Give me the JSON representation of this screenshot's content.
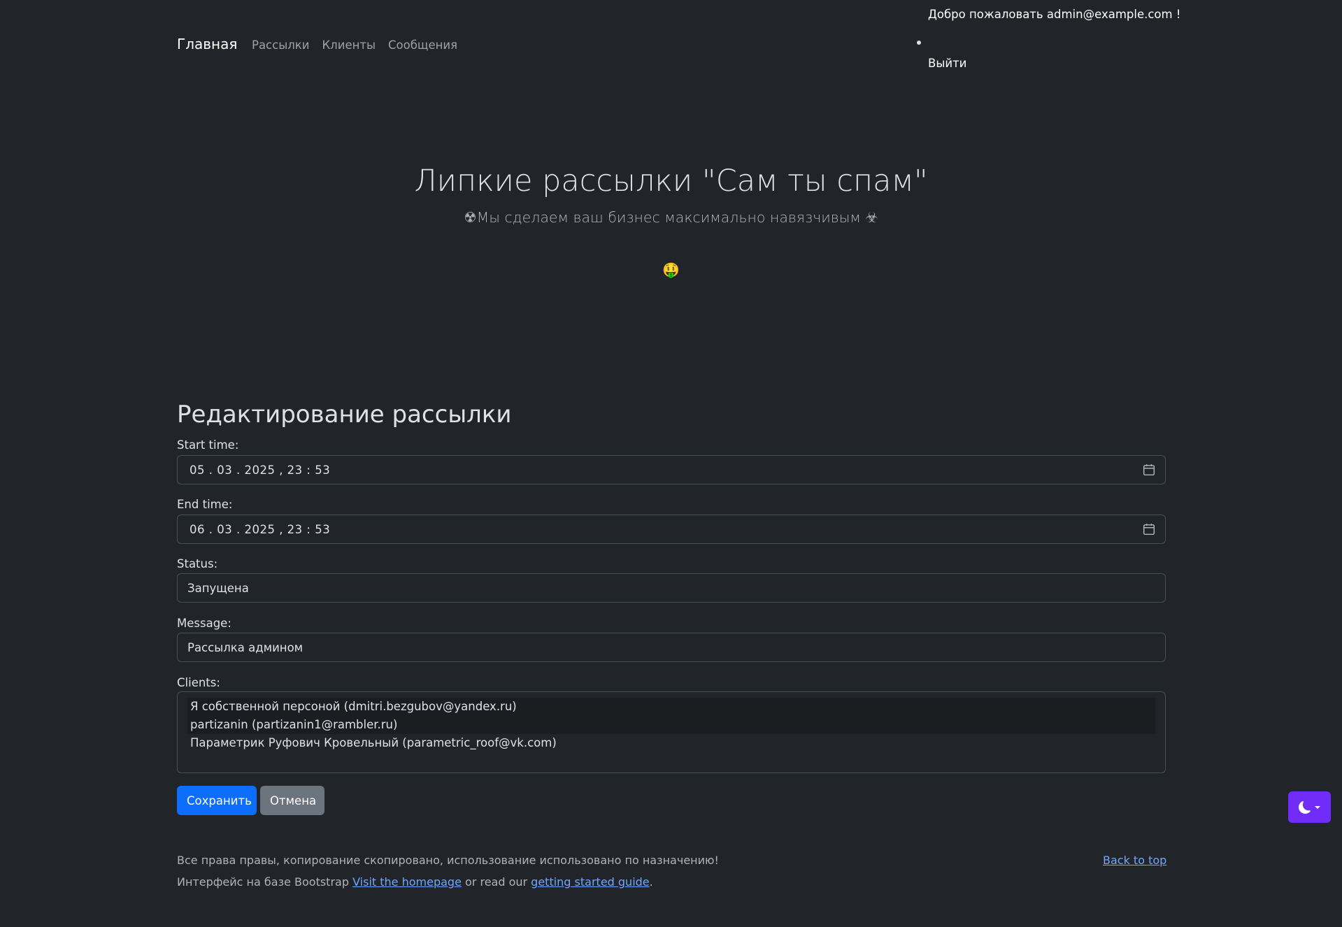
{
  "nav": {
    "brand": "Главная",
    "links": [
      "Рассылки",
      "Клиенты",
      "Сообщения"
    ],
    "welcome": "Добро пожаловать admin@example.com !",
    "logout": "Выйти"
  },
  "hero": {
    "title": "Липкие рассылки \"Сам ты спам\"",
    "subtitle": "☢Мы сделаем ваш бизнес максимально навязчивым ☣",
    "emoji": "🤑"
  },
  "form": {
    "title": "Редактирование рассылки",
    "start_label": "Start time:",
    "start_value": "05 . 03 . 2025 ,  23 : 53",
    "end_label": "End time:",
    "end_value": "06 . 03 . 2025 ,  23 : 53",
    "status_label": "Status:",
    "status_value": "Запущена",
    "message_label": "Message:",
    "message_value": "Рассылка админом",
    "clients_label": "Clients:",
    "clients": [
      "Я собственной персоной (dmitri.bezgubov@yandex.ru)",
      "partizanin (partizanin1@rambler.ru)",
      "Параметрик Руфович Кровельный (parametric_roof@vk.com)"
    ],
    "save_label": "Сохранить",
    "cancel_label": "Отмена"
  },
  "footer": {
    "copyright": "Все права правы, копирование скопировано, использование использовано по назначению!",
    "bootstrap_prefix": "Интерфейс на базе Bootstrap ",
    "homepage_link": "Visit the homepage",
    "middle": " or read our ",
    "guide_link": "getting started guide",
    "suffix": ".",
    "back_to_top": "Back to top"
  },
  "colors": {
    "background": "#212529",
    "primary": "#0d6efd",
    "secondary": "#6c757d",
    "link": "#6ea8fe",
    "theme_button": "#712cf9"
  },
  "icons": {
    "calendar": "calendar-icon",
    "theme": "moon-icon"
  }
}
